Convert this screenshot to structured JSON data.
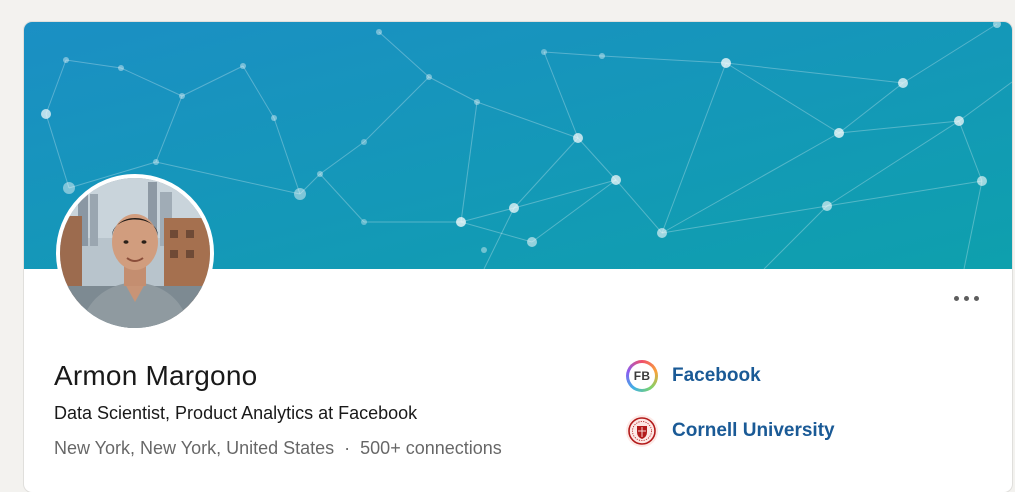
{
  "profile": {
    "name": "Armon Margono",
    "headline": "Data Scientist, Product Analytics at Facebook",
    "location": "New York, New York, United States",
    "separator": "·",
    "connections": "500+ connections"
  },
  "organizations": [
    {
      "name": "Facebook",
      "logo_text": "FB",
      "icon": "facebook-logo-icon"
    },
    {
      "name": "Cornell University",
      "icon": "cornell-seal-icon"
    }
  ],
  "actions": {
    "more_icon": "more-horizontal-icon"
  },
  "colors": {
    "banner_start": "#1b8fc4",
    "banner_end": "#109fb0",
    "link": "#1a5a96",
    "cornell_red": "#b31b1b"
  }
}
